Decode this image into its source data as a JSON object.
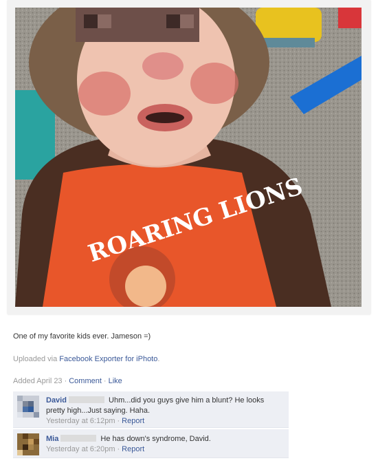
{
  "photo": {
    "shirt_text": "ROARING LIONS"
  },
  "post": {
    "caption": "One of my favorite kids ever. Jameson =)",
    "uploaded_prefix": "Uploaded via",
    "uploaded_app": "Facebook Exporter for iPhoto",
    "uploaded_suffix": ".",
    "added": "Added April 23",
    "comment_link": "Comment",
    "like_link": "Like"
  },
  "comments": [
    {
      "name": "David",
      "text": "Uhm...did you guys give him a blunt? He looks pretty high...Just saying. Haha.",
      "time": "Yesterday at 6:12pm",
      "report": "Report"
    },
    {
      "name": "Mia",
      "text": "He has down's syndrome, David.",
      "time": "Yesterday at 6:20pm",
      "report": "Report"
    }
  ],
  "separator": "·",
  "colors": {
    "link": "#3b5998",
    "comment_bg": "#edeff4",
    "shirt": "#e8562a",
    "sleeve": "#4a2e22"
  }
}
